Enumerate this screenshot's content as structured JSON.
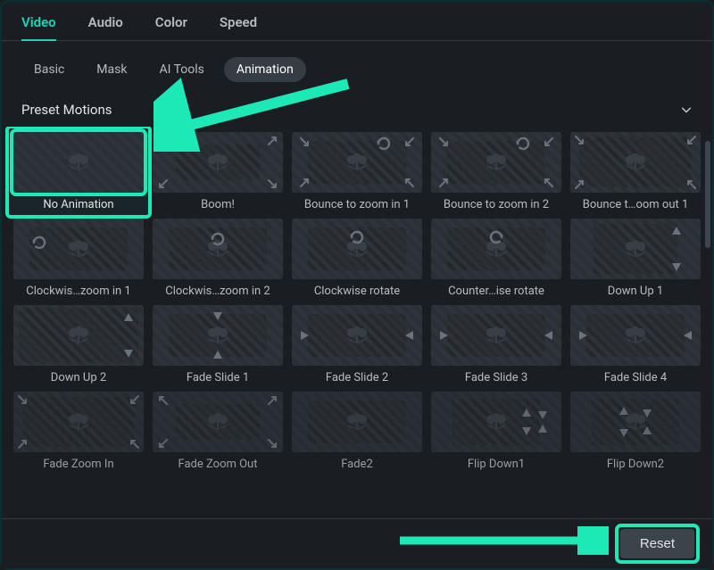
{
  "top_tabs": {
    "items": [
      {
        "label": "Video",
        "active": true
      },
      {
        "label": "Audio",
        "active": false
      },
      {
        "label": "Color",
        "active": false
      },
      {
        "label": "Speed",
        "active": false
      }
    ]
  },
  "sub_tabs": {
    "items": [
      {
        "label": "Basic",
        "active": false
      },
      {
        "label": "Mask",
        "active": false
      },
      {
        "label": "AI Tools",
        "active": false
      },
      {
        "label": "Animation",
        "active": true
      }
    ]
  },
  "section": {
    "title": "Preset Motions"
  },
  "presets": [
    {
      "label": "No Animation",
      "style": "noanim",
      "selected": true
    },
    {
      "label": "Boom!",
      "style": "boom"
    },
    {
      "label": "Bounce to zoom in 1",
      "style": "bounce-in"
    },
    {
      "label": "Bounce to zoom in 2",
      "style": "bounce-in"
    },
    {
      "label": "Bounce t…oom out 1",
      "style": "bounce-out"
    },
    {
      "label": "Clockwis…zoom in 1",
      "style": "cw-zoom"
    },
    {
      "label": "Clockwis…zoom in 2",
      "style": "cw"
    },
    {
      "label": "Clockwise rotate",
      "style": "cw-rot"
    },
    {
      "label": "Counter…ise rotate",
      "style": "ccw-rot"
    },
    {
      "label": "Down Up 1",
      "style": "down-up"
    },
    {
      "label": "Down Up 2",
      "style": "down-up-full"
    },
    {
      "label": "Fade Slide 1",
      "style": "fade-slide-v"
    },
    {
      "label": "Fade Slide 2",
      "style": "fade-slide-lr"
    },
    {
      "label": "Fade Slide 3",
      "style": "fade-slide-lr"
    },
    {
      "label": "Fade Slide 4",
      "style": "fade-slide-lr"
    },
    {
      "label": "Fade Zoom In",
      "style": "fade-zoom-in",
      "faded": true
    },
    {
      "label": "Fade Zoom Out",
      "style": "fade-zoom-out",
      "faded": true
    },
    {
      "label": "Fade2",
      "style": "fade",
      "faded": true
    },
    {
      "label": "Flip Down1",
      "style": "flip-down",
      "faded": true
    },
    {
      "label": "Flip Down2",
      "style": "flip-down2",
      "faded": true
    }
  ],
  "footer": {
    "reset_label": "Reset"
  },
  "colors": {
    "accent": "#18d8b8",
    "highlight": "#1de9b6"
  }
}
